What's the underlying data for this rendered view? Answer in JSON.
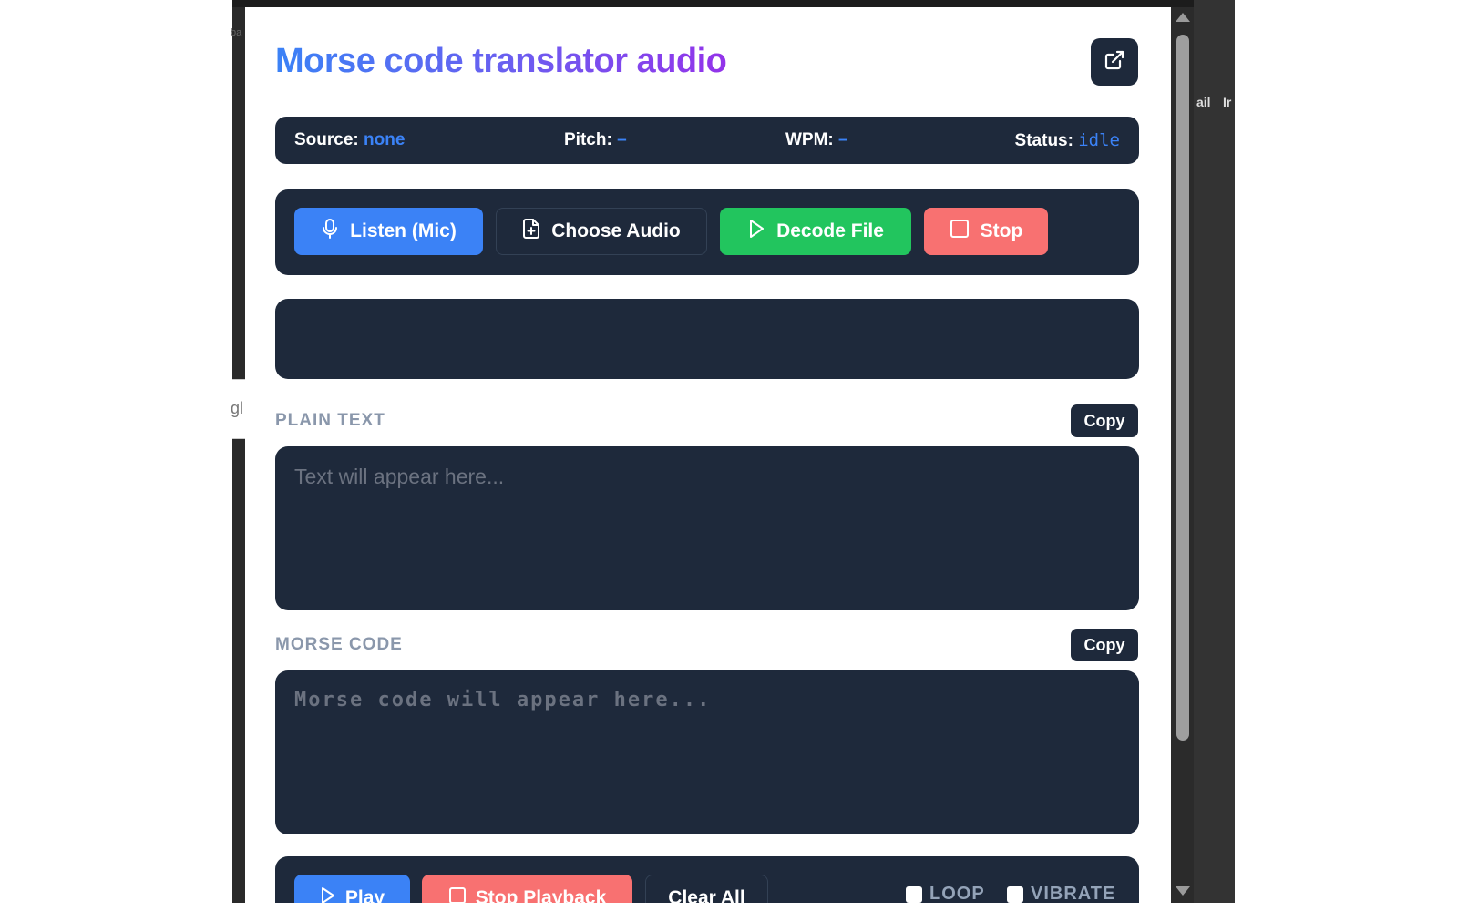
{
  "background": {
    "right_text_1": "ail",
    "right_text_2": "Ir",
    "left_text_1": "ba",
    "left_text_2": "gl"
  },
  "header": {
    "title": "Morse code translator audio",
    "open_external_icon": "external-link-icon"
  },
  "status_bar": {
    "source_label": "Source:",
    "source_value": "none",
    "pitch_label": "Pitch:",
    "pitch_value": "–",
    "wpm_label": "WPM:",
    "wpm_value": "–",
    "status_label": "Status:",
    "status_value": "idle"
  },
  "actions": {
    "listen_label": "Listen (Mic)",
    "choose_label": "Choose Audio",
    "decode_label": "Decode File",
    "stop_label": "Stop"
  },
  "plain_text": {
    "label": "PLAIN TEXT",
    "copy_label": "Copy",
    "value": "",
    "placeholder": "Text will appear here..."
  },
  "morse_code": {
    "label": "MORSE CODE",
    "copy_label": "Copy",
    "value": "",
    "placeholder": "Morse code will appear here..."
  },
  "playback": {
    "play_label": "Play",
    "stop_playback_label": "Stop Playback",
    "clear_label": "Clear All",
    "loop_label": "LOOP",
    "vibrate_label": "VIBRATE"
  },
  "colors": {
    "panel_dark": "#1e293b",
    "accent_blue": "#3b82f6",
    "accent_green": "#22c55e",
    "accent_red": "#f87171"
  }
}
